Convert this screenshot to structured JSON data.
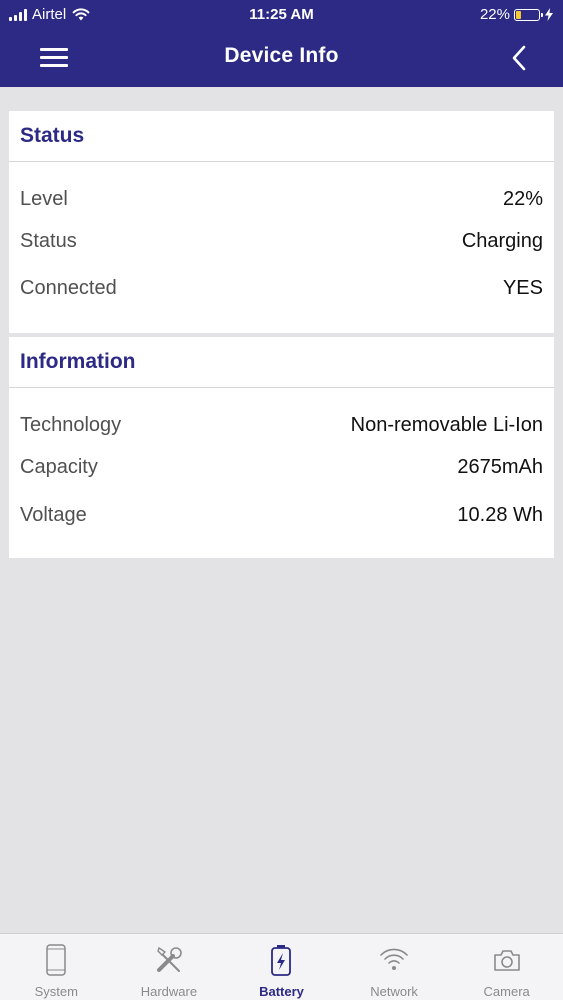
{
  "status_bar": {
    "carrier": "Airtel",
    "time": "11:25 AM",
    "battery_percent": "22%",
    "battery_level": 0.22,
    "icons": [
      "signal-icon",
      "wifi-icon",
      "battery-icon",
      "charging-bolt-icon"
    ]
  },
  "nav": {
    "title": "Device Info",
    "icons": [
      "menu-icon",
      "back-chevron-icon"
    ]
  },
  "status_section": {
    "title": "Status",
    "rows": [
      {
        "label": "Level",
        "value": "22%"
      },
      {
        "label": "Status",
        "value": "Charging"
      },
      {
        "label": "Connected",
        "value": "YES"
      }
    ]
  },
  "information_section": {
    "title": "Information",
    "rows": [
      {
        "label": "Technology",
        "value": "Non-removable Li-Ion"
      },
      {
        "label": "Capacity",
        "value": "2675mAh"
      },
      {
        "label": "Voltage",
        "value": "10.28 Wh"
      }
    ]
  },
  "tabs": [
    {
      "label": "System",
      "icon": "phone-icon",
      "active": false
    },
    {
      "label": "Hardware",
      "icon": "tools-icon",
      "active": false
    },
    {
      "label": "Battery",
      "icon": "battery-charging-icon",
      "active": true
    },
    {
      "label": "Network",
      "icon": "wifi-icon",
      "active": false
    },
    {
      "label": "Camera",
      "icon": "camera-icon",
      "active": false
    }
  ],
  "colors": {
    "primary": "#2c2a85",
    "background": "#e3e2e5",
    "card": "#ffffff",
    "tab_inactive": "#8a8a8e"
  }
}
